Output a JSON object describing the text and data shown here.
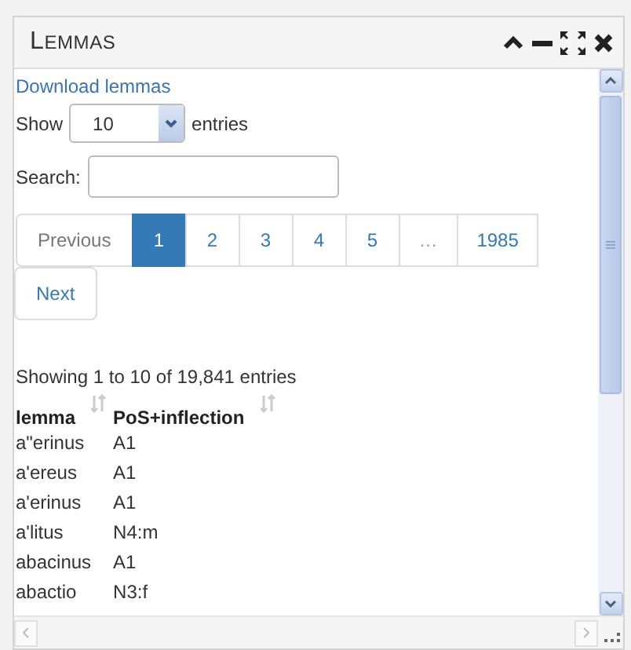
{
  "window": {
    "title": "LEMMAS"
  },
  "download_link": "Download lemmas",
  "length": {
    "prefix": "Show",
    "value": "10",
    "suffix": "entries"
  },
  "search": {
    "label": "Search:"
  },
  "pagination": [
    {
      "label": "Previous",
      "kind": "nav",
      "selected": false
    },
    {
      "label": "1",
      "kind": "page",
      "selected": true
    },
    {
      "label": "2",
      "kind": "page",
      "selected": false
    },
    {
      "label": "3",
      "kind": "page",
      "selected": false
    },
    {
      "label": "4",
      "kind": "page",
      "selected": false
    },
    {
      "label": "5",
      "kind": "page",
      "selected": false
    },
    {
      "label": "…",
      "kind": "ellipsis",
      "selected": false
    },
    {
      "label": "1985",
      "kind": "page",
      "selected": false
    },
    {
      "label": "Next",
      "kind": "nav",
      "selected": false
    }
  ],
  "info": "Showing 1 to 10 of 19,841 entries",
  "table": {
    "columns": [
      "lemma",
      "PoS+inflection"
    ],
    "rows": [
      [
        "a\"erinus",
        "A1"
      ],
      [
        "a'ereus",
        "A1"
      ],
      [
        "a'erinus",
        "A1"
      ],
      [
        "a'litus",
        "N4:m"
      ],
      [
        "abacinus",
        "A1"
      ],
      [
        "abactio",
        "N3:f"
      ]
    ]
  }
}
